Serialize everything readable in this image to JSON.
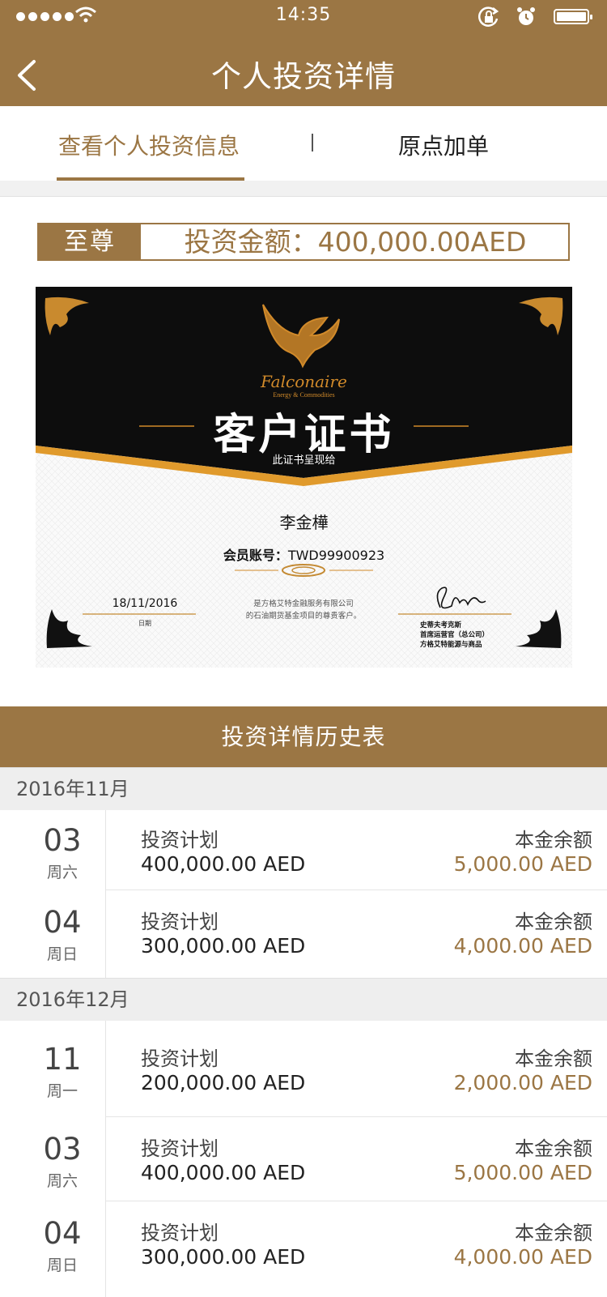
{
  "status_bar": {
    "time": "14:35"
  },
  "nav": {
    "title": "个人投资详情"
  },
  "tabs": [
    {
      "label": "查看个人投资信息"
    },
    {
      "label": "原点加单"
    }
  ],
  "level": {
    "tag": "至尊",
    "amount": "投资金额：400,000.00AED"
  },
  "certificate": {
    "brand": "Falconaire",
    "brand_sub": "Energy & Commodities",
    "title": "客户证书",
    "subtitle": "此证书呈现给",
    "name": "李金樺",
    "account_label": "会员账号：",
    "account": "TWD99900923",
    "date": "18/11/2016",
    "date_label": "日期",
    "text_line1": "是方格艾特金融服务有限公司",
    "text_line2": "的石油期货基金项目的尊贵客户。",
    "sign_line1": "史蒂夫考克斯",
    "sign_line2": "首席运营官（总公司）",
    "sign_line3": "方格艾特能源与商品"
  },
  "history": {
    "title": "投资详情历史表",
    "months": [
      {
        "label": "2016年11月",
        "items": [
          {
            "day": "03",
            "weekday": "周六",
            "plan_label": "投资计划",
            "plan_value": "400,000.00 AED",
            "balance_label": "本金余额",
            "balance_value": "5,000.00 AED"
          },
          {
            "day": "04",
            "weekday": "周日",
            "plan_label": "投资计划",
            "plan_value": "300,000.00 AED",
            "balance_label": "本金余额",
            "balance_value": "4,000.00 AED"
          }
        ]
      },
      {
        "label": "2016年12月",
        "items": [
          {
            "day": "11",
            "weekday": "周一",
            "plan_label": "投资计划",
            "plan_value": "200,000.00 AED",
            "balance_label": "本金余额",
            "balance_value": "2,000.00 AED"
          },
          {
            "day": "03",
            "weekday": "周六",
            "plan_label": "投资计划",
            "plan_value": "400,000.00 AED",
            "balance_label": "本金余额",
            "balance_value": "5,000.00 AED"
          },
          {
            "day": "04",
            "weekday": "周日",
            "plan_label": "投资计划",
            "plan_value": "300,000.00 AED",
            "balance_label": "本金余额",
            "balance_value": "4,000.00 AED"
          }
        ]
      }
    ]
  },
  "colors": {
    "brand": "#9b7644",
    "accent_gold": "#d18a2a",
    "panel_gray": "#eeeeee"
  }
}
